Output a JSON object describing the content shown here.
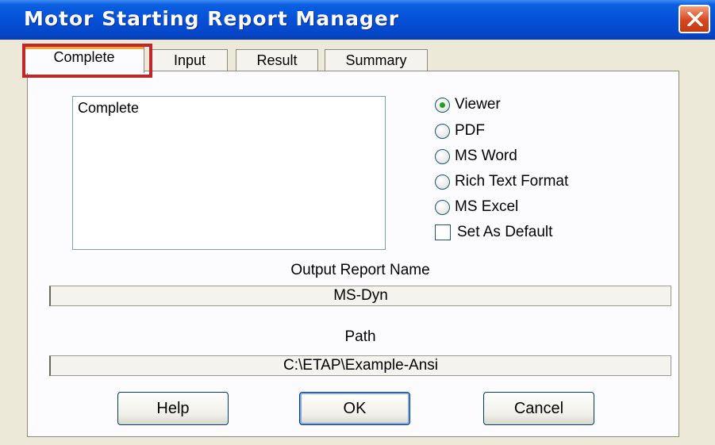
{
  "window": {
    "title": "Motor Starting Report Manager",
    "close_icon": "close-icon"
  },
  "tabs": [
    {
      "label": "Complete",
      "active": true
    },
    {
      "label": "Input"
    },
    {
      "label": "Result"
    },
    {
      "label": "Summary"
    }
  ],
  "report_list": {
    "items": [
      "Complete"
    ]
  },
  "output_options": [
    {
      "label": "Viewer",
      "checked": true
    },
    {
      "label": "PDF",
      "checked": false
    },
    {
      "label": "MS Word",
      "checked": false
    },
    {
      "label": "Rich Text Format",
      "checked": false
    },
    {
      "label": "MS Excel",
      "checked": false
    }
  ],
  "set_default": {
    "label": "Set As Default",
    "checked": false
  },
  "output_report_name": {
    "label": "Output Report Name",
    "value": "MS-Dyn"
  },
  "path": {
    "label": "Path",
    "value": "C:\\ETAP\\Example-Ansi"
  },
  "buttons": {
    "help": "Help",
    "ok": "OK",
    "cancel": "Cancel"
  },
  "colors": {
    "title_bar": "#0550d8",
    "highlight": "#c1262b",
    "radio_dot": "#21a121"
  }
}
